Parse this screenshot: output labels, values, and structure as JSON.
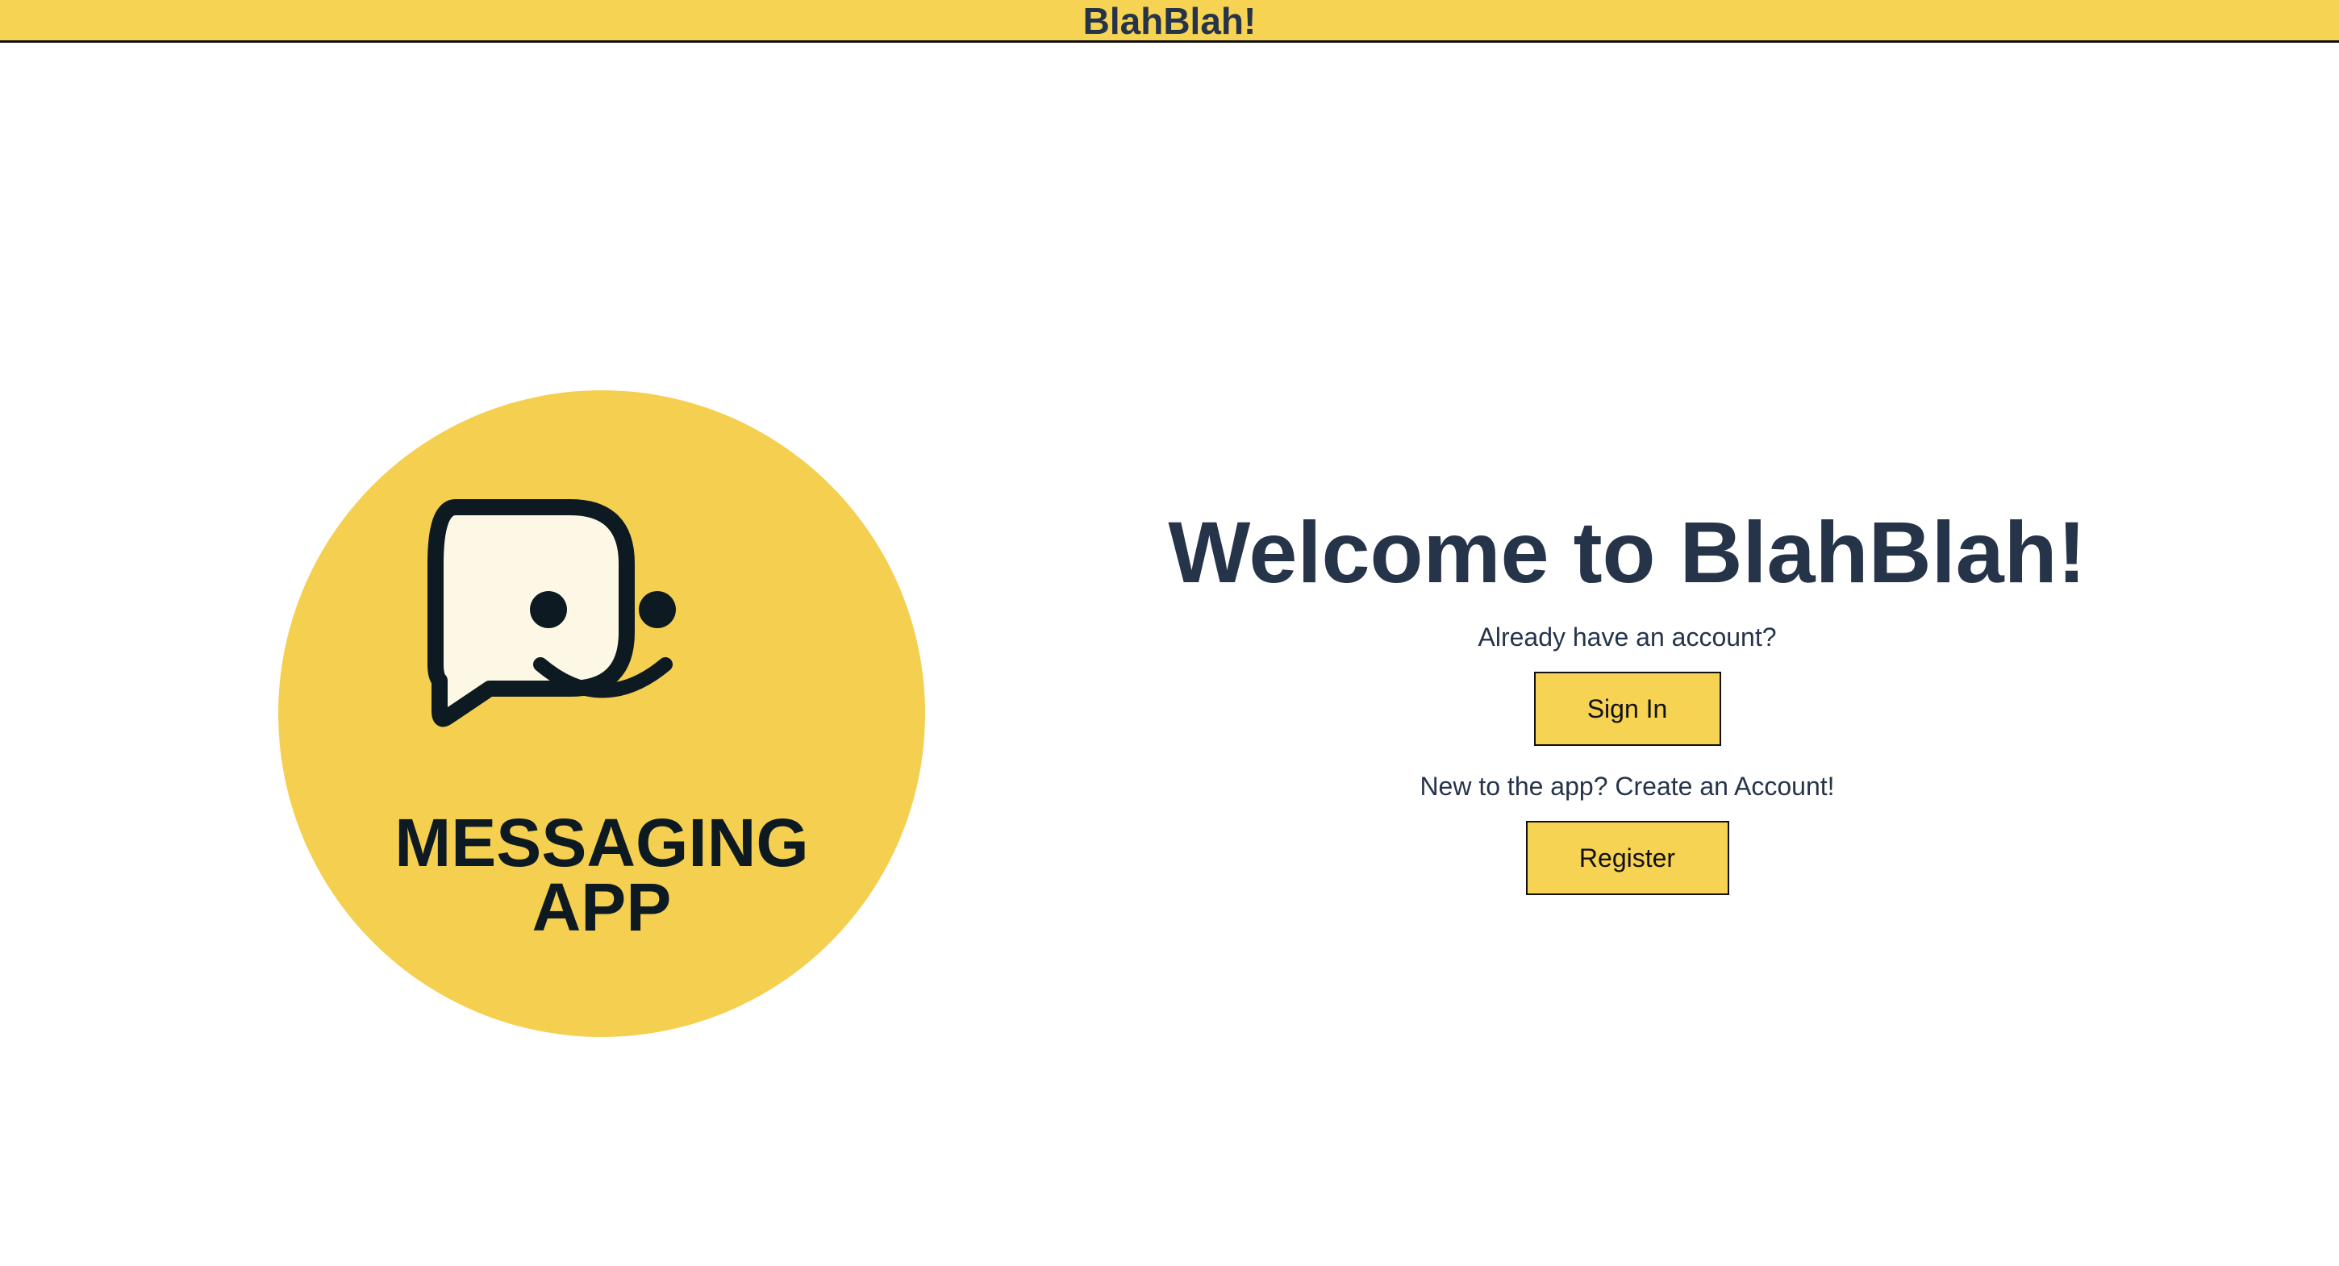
{
  "header": {
    "title": "BlahBlah!"
  },
  "logo": {
    "line1": "MESSAGING",
    "line2": "APP",
    "icon": "smiling-chat-bubble-icon"
  },
  "welcome": {
    "headline": "Welcome to BlahBlah!",
    "signin_prompt": "Already have an account?",
    "signin_label": "Sign In",
    "register_prompt": "New to the app? Create an Account!",
    "register_label": "Register"
  },
  "colors": {
    "brand_yellow": "#f7d354",
    "text_navy": "#26344a",
    "outline": "#111111"
  }
}
